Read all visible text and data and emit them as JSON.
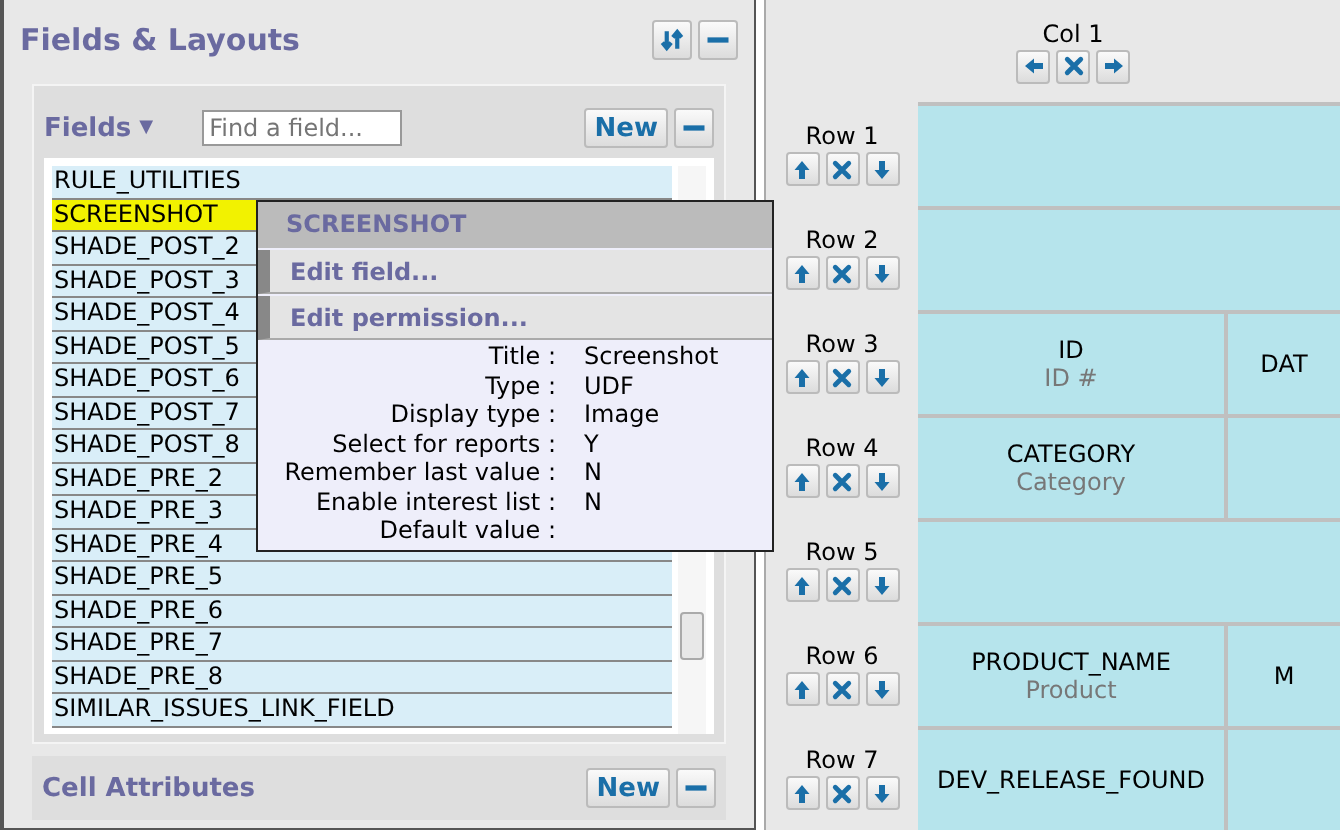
{
  "panel": {
    "title": "Fields & Layouts"
  },
  "fields": {
    "title": "Fields",
    "caret": "▼",
    "search": {
      "placeholder": "Find a field..."
    },
    "new_button": "New",
    "items": [
      {
        "label": "RULE_UTILITIES",
        "selected": false
      },
      {
        "label": "SCREENSHOT",
        "selected": true
      },
      {
        "label": "SHADE_POST_2",
        "selected": false
      },
      {
        "label": "SHADE_POST_3",
        "selected": false
      },
      {
        "label": "SHADE_POST_4",
        "selected": false
      },
      {
        "label": "SHADE_POST_5",
        "selected": false
      },
      {
        "label": "SHADE_POST_6",
        "selected": false
      },
      {
        "label": "SHADE_POST_7",
        "selected": false
      },
      {
        "label": "SHADE_POST_8",
        "selected": false
      },
      {
        "label": "SHADE_PRE_2",
        "selected": false
      },
      {
        "label": "SHADE_PRE_3",
        "selected": false
      },
      {
        "label": "SHADE_PRE_4",
        "selected": false
      },
      {
        "label": "SHADE_PRE_5",
        "selected": false
      },
      {
        "label": "SHADE_PRE_6",
        "selected": false
      },
      {
        "label": "SHADE_PRE_7",
        "selected": false
      },
      {
        "label": "SHADE_PRE_8",
        "selected": false
      },
      {
        "label": "SIMILAR_ISSUES_LINK_FIELD",
        "selected": false
      }
    ]
  },
  "popup": {
    "title": "SCREENSHOT",
    "actions": [
      "Edit field...",
      "Edit permission..."
    ],
    "properties": [
      {
        "label": "Title :",
        "value": "Screenshot"
      },
      {
        "label": "Type :",
        "value": "UDF"
      },
      {
        "label": "Display type :",
        "value": "Image"
      },
      {
        "label": "Select for reports :",
        "value": "Y"
      },
      {
        "label": "Remember last value :",
        "value": "N"
      },
      {
        "label": "Enable interest list :",
        "value": "N"
      },
      {
        "label": "Default value :"
      }
    ]
  },
  "cell_attributes": {
    "title": "Cell Attributes",
    "new_button": "New"
  },
  "layout": {
    "column": "Col 1",
    "rows": [
      {
        "label": "Row 1",
        "cells": [
          {}
        ]
      },
      {
        "label": "Row 2",
        "cells": [
          {}
        ]
      },
      {
        "label": "Row 3",
        "cells": [
          {
            "name": "ID",
            "title": "ID #"
          },
          {
            "name": "DAT"
          }
        ]
      },
      {
        "label": "Row 4",
        "cells": [
          {
            "name": "CATEGORY",
            "title": "Category"
          },
          {}
        ]
      },
      {
        "label": "Row 5",
        "cells": [
          {}
        ]
      },
      {
        "label": "Row 6",
        "cells": [
          {
            "name": "PRODUCT_NAME",
            "title": "Product"
          },
          {
            "name": "M"
          }
        ]
      },
      {
        "label": "Row 7",
        "cells": [
          {
            "name": "DEV_RELEASE_FOUND"
          },
          {}
        ]
      }
    ]
  }
}
